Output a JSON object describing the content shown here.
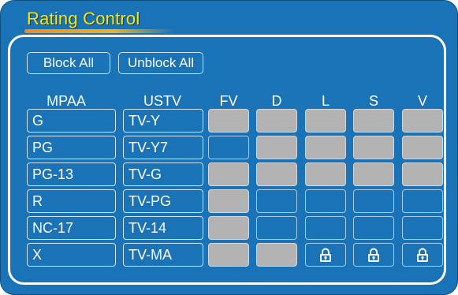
{
  "title": "Rating Control",
  "buttons": {
    "block_all": "Block All",
    "unblock_all": "Unblock All"
  },
  "headers": {
    "mpaa": "MPAA",
    "ustv": "USTV",
    "fv": "FV",
    "d": "D",
    "l": "L",
    "s": "S",
    "v": "V"
  },
  "rows": [
    {
      "mpaa": "G",
      "ustv": "TV-Y",
      "cells": [
        "on",
        "on",
        "on",
        "on",
        "on"
      ]
    },
    {
      "mpaa": "PG",
      "ustv": "TV-Y7",
      "cells": [
        "off",
        "on",
        "on",
        "on",
        "on"
      ]
    },
    {
      "mpaa": "PG-13",
      "ustv": "TV-G",
      "cells": [
        "on",
        "on",
        "on",
        "on",
        "on"
      ]
    },
    {
      "mpaa": "R",
      "ustv": "TV-PG",
      "cells": [
        "on",
        "off",
        "off",
        "off",
        "off"
      ]
    },
    {
      "mpaa": "NC-17",
      "ustv": "TV-14",
      "cells": [
        "on",
        "off",
        "off",
        "off",
        "off"
      ]
    },
    {
      "mpaa": "X",
      "ustv": "TV-MA",
      "cells": [
        "on",
        "on",
        "locked",
        "locked",
        "locked"
      ]
    }
  ],
  "colors": {
    "background": "#1a73b6",
    "title": "#ffe600",
    "blocked_cell": "#b3b3b3"
  },
  "icons": {
    "locked_cell": "lock-icon"
  }
}
